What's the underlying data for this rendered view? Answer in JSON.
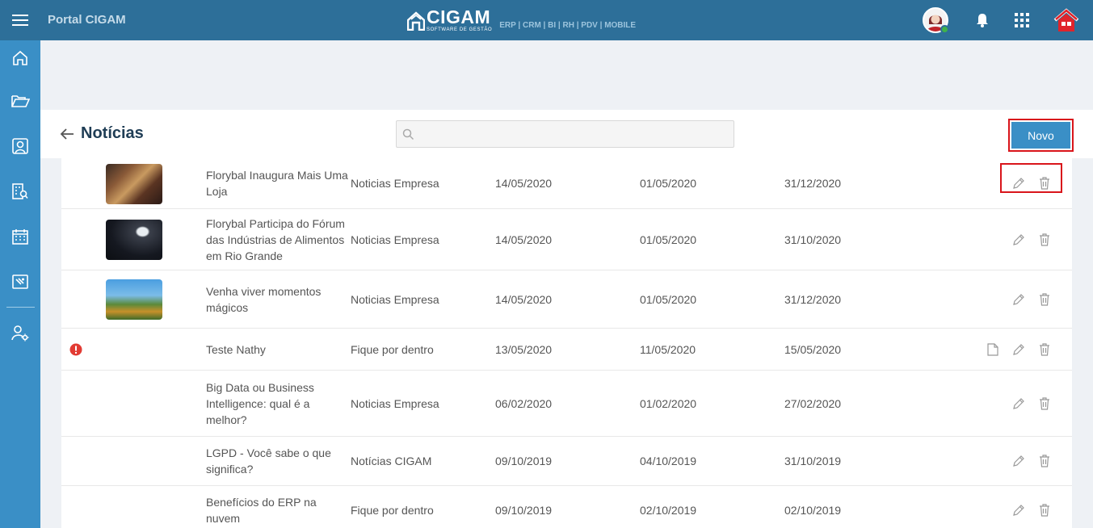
{
  "app": {
    "portal_title": "Portal CIGAM",
    "brand_name": "CIGAM",
    "brand_tagline": "SOFTWARE DE GESTÃO",
    "brand_modules": "ERP | CRM | BI | RH | PDV | MOBILE"
  },
  "colors": {
    "topbar": "#2d6f99",
    "sidebar": "#3a8fc6",
    "primary": "#3a8fc6",
    "highlight": "#d9151b"
  },
  "sidebar": {
    "items": [
      {
        "icon": "home-icon"
      },
      {
        "icon": "folder-open-icon"
      },
      {
        "icon": "portrait-icon"
      },
      {
        "icon": "org-search-icon"
      },
      {
        "icon": "calendar-icon"
      },
      {
        "icon": "ticket-icon"
      },
      {
        "icon": "user-settings-icon"
      }
    ]
  },
  "header": {
    "title": "Notícias",
    "search_placeholder": "",
    "new_button": "Novo"
  },
  "news": [
    {
      "title": "Florybal Inaugura Mais Uma Loja",
      "category": "Noticias Empresa",
      "published": "14/05/2020",
      "start": "01/05/2020",
      "end": "31/12/2020",
      "image": "store-photo",
      "alert": false,
      "attach": false
    },
    {
      "title": "Florybal Participa do Fórum das Indústrias de Alimentos em Rio Grande",
      "category": "Noticias Empresa",
      "published": "14/05/2020",
      "start": "01/05/2020",
      "end": "31/10/2020",
      "image": "forum-photo",
      "alert": false,
      "attach": false
    },
    {
      "title": "Venha viver momentos mágicos",
      "category": "Noticias Empresa",
      "published": "14/05/2020",
      "start": "01/05/2020",
      "end": "31/12/2020",
      "image": "park-photo",
      "alert": false,
      "attach": false
    },
    {
      "title": "Teste Nathy",
      "category": "Fique por dentro",
      "published": "13/05/2020",
      "start": "11/05/2020",
      "end": "15/05/2020",
      "image": "",
      "alert": true,
      "attach": true
    },
    {
      "title": "Big Data ou Business Intelligence: qual é a melhor?",
      "category": "Noticias Empresa",
      "published": "06/02/2020",
      "start": "01/02/2020",
      "end": "27/02/2020",
      "image": "",
      "alert": false,
      "attach": false
    },
    {
      "title": "LGPD - Você sabe o que significa?",
      "category": "Notícias CIGAM",
      "published": "09/10/2019",
      "start": "04/10/2019",
      "end": "31/10/2019",
      "image": "",
      "alert": false,
      "attach": false
    },
    {
      "title": "Benefícios do ERP na nuvem",
      "category": "Fique por dentro",
      "published": "09/10/2019",
      "start": "02/10/2019",
      "end": "02/10/2019",
      "image": "",
      "alert": false,
      "attach": false
    }
  ]
}
